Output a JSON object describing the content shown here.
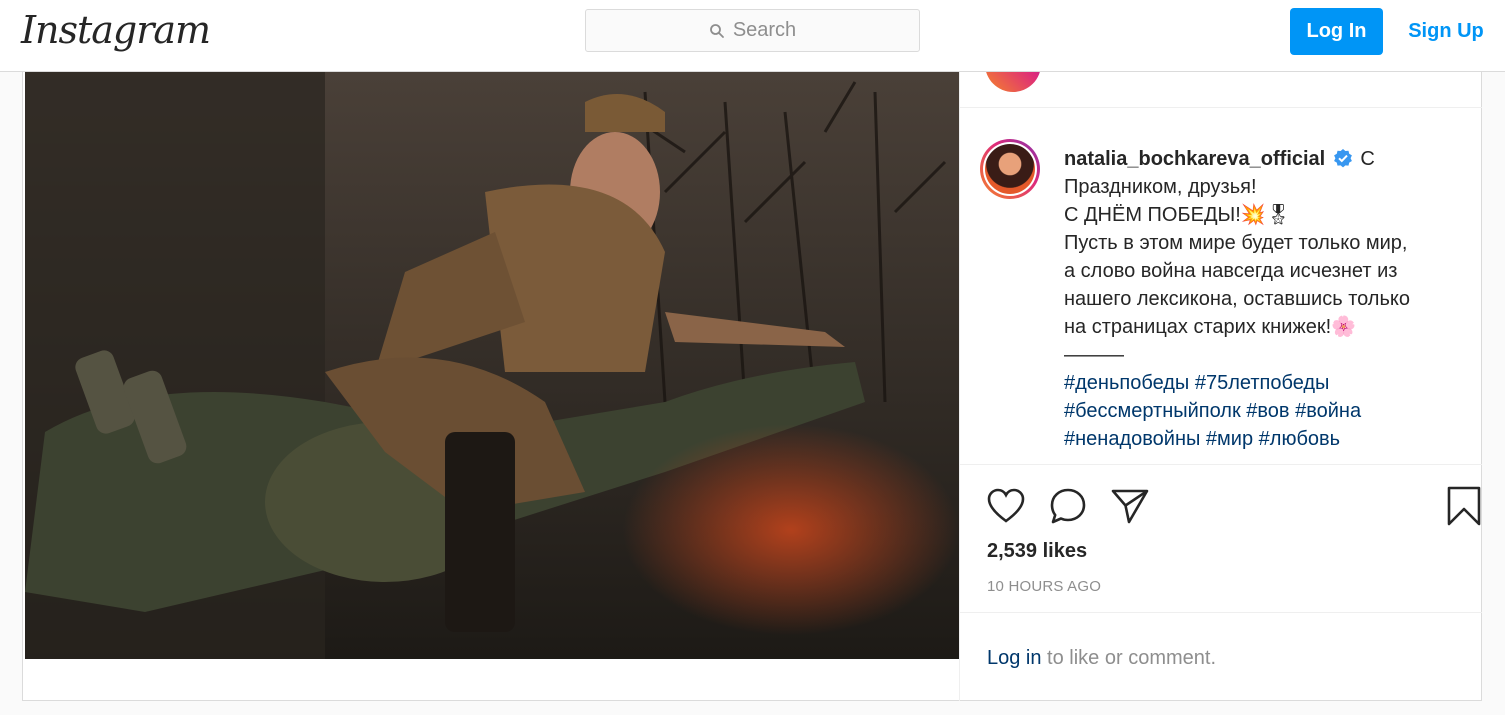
{
  "header": {
    "logo_text": "Instagram",
    "search_placeholder": "Search",
    "login_label": "Log In",
    "signup_label": "Sign Up"
  },
  "post": {
    "username": "natalia_bochkareva_official",
    "caption_lines": [
      "С",
      "Праздником, друзья!",
      "С ДНЁМ ПОБЕДЫ!💥🎖",
      "Пусть в этом мире будет только мир,",
      "а слово война навсегда исчезнет из",
      "нашего лексикона, оставшись только",
      "на страницах старих книжек!🌸",
      "———"
    ],
    "hashtag_lines": [
      "#деньпобеды #75летпобеды",
      "#бессмертныйполк #вов #война",
      "#ненадовойны #мир #любовь"
    ],
    "likes": "2,539 likes",
    "time_ago": "10 HOURS AGO",
    "comment_prompt": {
      "link": "Log in",
      "rest": " to like or comment."
    }
  },
  "icons": [
    "search-icon",
    "verified-badge-icon",
    "heart-icon",
    "comment-icon",
    "share-icon",
    "bookmark-icon"
  ],
  "colors": {
    "accent": "#0095f6",
    "link": "#00376b",
    "muted": "#8e8e8e",
    "border": "#dbdbdb",
    "verified": "#3897f0"
  }
}
